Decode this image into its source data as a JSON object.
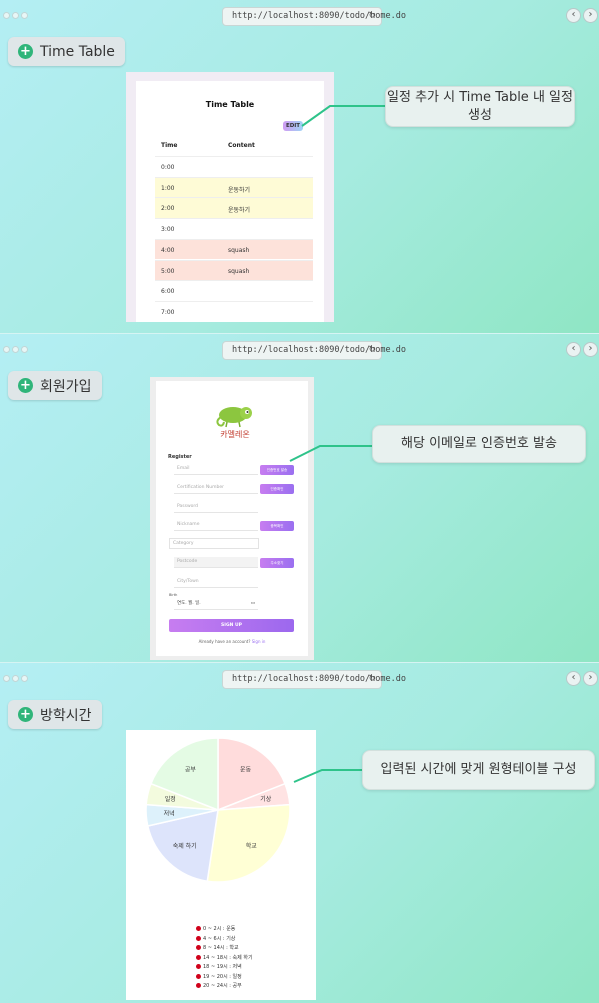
{
  "browser": {
    "url": "http://localhost:8090/todo/home.do",
    "reload_icon": "↻",
    "back_icon": "‹",
    "forward_icon": "›"
  },
  "panels": [
    {
      "tag": "Time Table",
      "callout": "일정 추가 시 Time Table 내 일정 생성"
    },
    {
      "tag": "회원가입",
      "callout": "해당 이메일로 인증번호 발송"
    },
    {
      "tag": "방학시간",
      "callout": "입력된 시간에 맞게 원형테이블 구성"
    }
  ],
  "timetable": {
    "title": "Time Table",
    "edit_label": "EDIT",
    "col_time": "Time",
    "col_content": "Content",
    "rows": [
      {
        "time": "0:00",
        "content": "",
        "color": "#ffffff"
      },
      {
        "time": "1:00",
        "content": "운동하기",
        "color": "#fefbd6"
      },
      {
        "time": "2:00",
        "content": "운동하기",
        "color": "#fefbd6"
      },
      {
        "time": "3:00",
        "content": "",
        "color": "#ffffff"
      },
      {
        "time": "4:00",
        "content": "squash",
        "color": "#fde2da"
      },
      {
        "time": "5:00",
        "content": "squash",
        "color": "#fde2da"
      },
      {
        "time": "6:00",
        "content": "",
        "color": "#ffffff"
      },
      {
        "time": "7:00",
        "content": "",
        "color": "#ffffff"
      }
    ]
  },
  "register": {
    "logo_text": "카멜레온",
    "title": "Register",
    "email_placeholder": "Email",
    "email_btn": "인증번호 발송",
    "cert_placeholder": "Certification Number",
    "cert_btn": "인증확인",
    "password_placeholder": "Password",
    "nickname_placeholder": "Nickname",
    "nickname_btn": "중복확인",
    "category_placeholder": "Category",
    "postcode_placeholder": "Postcode",
    "postcode_btn": "주소찾기",
    "city_placeholder": "City/Town",
    "birth_label": "Birth",
    "birth_value": "연도. 월. 일.",
    "signup_label": "SIGN UP",
    "already_text": "Already have an account? ",
    "signin_link": "Sign in"
  },
  "chart_data": {
    "type": "pie",
    "slices": [
      {
        "label": "운동",
        "value": 4,
        "color": "#ffdcdc"
      },
      {
        "label": "기상",
        "value": 1,
        "color": "#ffe3e3"
      },
      {
        "label": "학교",
        "value": 6,
        "color": "#ffffd5"
      },
      {
        "label": "숙제 하기",
        "value": 4,
        "color": "#dde4fb"
      },
      {
        "label": "저녁",
        "value": 1,
        "color": "#ddf1fb"
      },
      {
        "label": "일정",
        "value": 1,
        "color": "#f3fbde"
      },
      {
        "label": "공부",
        "value": 4,
        "color": "#e4fbe4"
      }
    ],
    "legend": [
      "0 ~ 2시 : 운동",
      "4 ~ 6시 : 기상",
      "8 ~ 14시 : 학교",
      "14 ~ 18시 : 숙제 하기",
      "18 ~ 19시 : 저녁",
      "19 ~ 20시 : 일정",
      "20 ~ 24시 : 공부"
    ],
    "legend_color": "#d0021b"
  }
}
